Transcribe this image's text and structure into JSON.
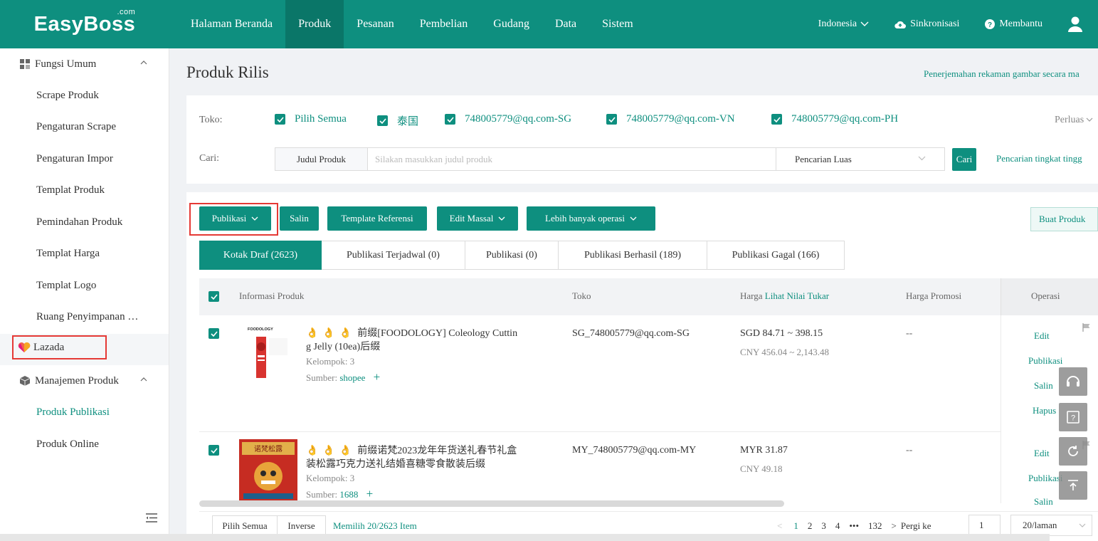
{
  "app": {
    "logo": "EasyBoss",
    "logo_suffix": ".com"
  },
  "nav": {
    "items": [
      "Halaman Beranda",
      "Produk",
      "Pesanan",
      "Pembelian",
      "Gudang",
      "Data",
      "Sistem"
    ],
    "active_index": 1
  },
  "top_right": {
    "region": "Indonesia",
    "sync": "Sinkronisasi",
    "help": "Membantu"
  },
  "sidebar": {
    "group1": "Fungsi Umum",
    "items1": [
      "Scrape Produk",
      "Pengaturan Scrape",
      "Pengaturan Impor",
      "Templat Produk",
      "Pemindahan Produk",
      "Templat Harga",
      "Templat Logo",
      "Ruang Penyimpanan …"
    ],
    "lazada": "Lazada",
    "group2": "Manajemen Produk",
    "items2": [
      "Produk Publikasi",
      "Produk Online"
    ]
  },
  "page": {
    "title": "Produk Rilis",
    "translate_link": "Penerjemahan rekaman gambar secara ma"
  },
  "filter": {
    "shop_label": "Toko:",
    "shops": [
      "Pilih Semua",
      "泰国",
      "748005779@qq.com-SG",
      "748005779@qq.com-VN",
      "748005779@qq.com-PH"
    ],
    "expand": "Perluas",
    "search_label": "Cari:",
    "search_type": "Judul Produk",
    "search_placeholder": "Silakan masukkan judul produk",
    "search_mode": "Pencarian Luas",
    "search_button": "Cari",
    "advanced": "Pencarian tingkat tingg"
  },
  "toolbar": {
    "publish": "Publikasi",
    "copy": "Salin",
    "template": "Template Referensi",
    "bulk_edit": "Edit Massal",
    "more": "Lebih banyak operasi",
    "create": "Buat Produk"
  },
  "tabs": [
    "Kotak Draf (2623)",
    "Publikasi Terjadwal (0)",
    "Publikasi (0)",
    "Publikasi Berhasil (189)",
    "Publikasi Gagal (166)"
  ],
  "table": {
    "headers": {
      "info": "Informasi Produk",
      "shop": "Toko",
      "price_prefix": "Harga",
      "price_link": "Lihat Nilai Tukar",
      "promo": "Harga Promosi",
      "ops": "Operasi"
    },
    "rows": [
      {
        "title_line1": "前缀[FOODOLOGY] Coleology Cuttin",
        "title_line2": "g Jelly (10ea)后缀",
        "group": "Kelompok:  3",
        "source_label": "Sumber:",
        "source": "shopee",
        "shop": "SG_748005779@qq.com-SG",
        "price": "SGD 84.71 ~ 398.15",
        "price_cny": "CNY 456.04 ~ 2,143.48",
        "promo": "--",
        "ops": [
          "Edit",
          "Publikasi",
          "Salin",
          "Hapus"
        ],
        "thumb_text": "FOODOLOGY"
      },
      {
        "title_line1": "前缀诺梵2023龙年年货送礼春节礼盒",
        "title_line2": "装松露巧克力送礼结婚喜糖零食散装后缀",
        "group": "Kelompok:  3",
        "source_label": "Sumber:",
        "source": "1688",
        "shop": "MY_748005779@qq.com-MY",
        "price": "MYR 31.87",
        "price_cny": "CNY 49.18",
        "promo": "--",
        "ops": [
          "Edit",
          "Publikasi",
          "Salin"
        ],
        "thumb_text": "诺梵松露"
      }
    ]
  },
  "footer": {
    "select_all": "Pilih Semua",
    "inverse": "Inverse",
    "selected": "Memilih 20/2623 Item",
    "pages": [
      "1",
      "2",
      "3",
      "4",
      "•••",
      "132"
    ],
    "goto_label": "Pergi ke",
    "goto_value": "1",
    "per_page": "20/laman"
  },
  "colors": {
    "brand": "#0e8f7f",
    "highlight": "#e53935"
  }
}
